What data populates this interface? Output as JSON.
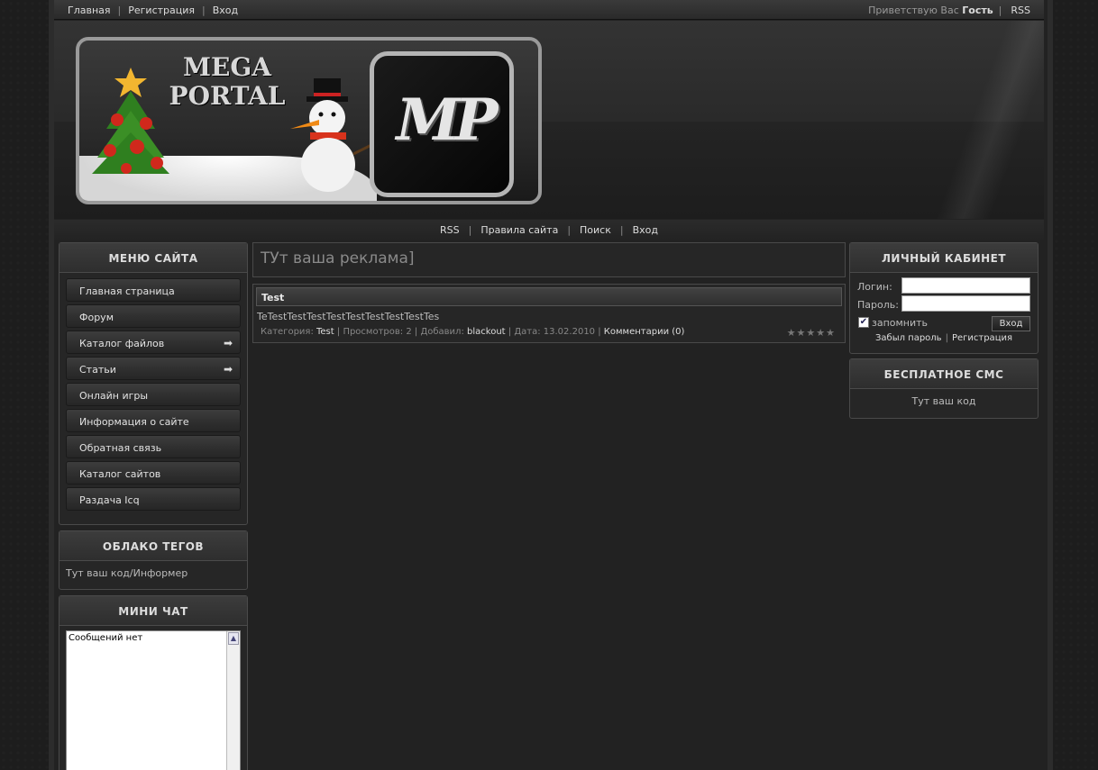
{
  "topbar": {
    "links": [
      "Главная",
      "Регистрация",
      "Вход"
    ],
    "greeting": "Приветствую Вас",
    "user": "Гость",
    "rss": "RSS"
  },
  "logo": {
    "line1": "MEGA",
    "line2": "PORTAL",
    "mark": "MP"
  },
  "navbar": {
    "links": [
      "RSS",
      "Правила сайта",
      "Поиск",
      "Вход"
    ]
  },
  "site_menu": {
    "title": "МЕНЮ САЙТА",
    "items": [
      {
        "label": "Главная страница",
        "arrow": false
      },
      {
        "label": "Форум",
        "arrow": false
      },
      {
        "label": "Каталог файлов",
        "arrow": true
      },
      {
        "label": "Статьи",
        "arrow": true
      },
      {
        "label": "Онлайн игры",
        "arrow": false
      },
      {
        "label": "Информация о сайте",
        "arrow": false
      },
      {
        "label": "Обратная связь",
        "arrow": false
      },
      {
        "label": "Каталог сайтов",
        "arrow": false
      },
      {
        "label": "Раздача Icq",
        "arrow": false
      }
    ]
  },
  "tag_cloud": {
    "title": "ОБЛАКО ТЕГОВ",
    "body": "Тут ваш код/Информер"
  },
  "mini_chat": {
    "title": "МИНИ ЧАТ",
    "message": "Сообщений нет"
  },
  "ad": {
    "text": "ТУт ваша реклама]"
  },
  "entry": {
    "title": "Test",
    "text": "TeTestTestTestTestTestTestTestTestTes",
    "category_label": "Категория:",
    "category": "Test",
    "views_label": "Просмотров:",
    "views": "2",
    "author_label": "Добавил:",
    "author": "blackout",
    "date_label": "Дата:",
    "date": "13.02.2010",
    "comments": "Комментарии (0)",
    "stars": "★★★★★"
  },
  "cabinet": {
    "title": "ЛИЧНЫЙ КАБИНЕТ",
    "login_label": "Логин:",
    "password_label": "Пароль:",
    "remember_label": "запомнить",
    "submit": "Вход",
    "forgot": "Забыл пароль",
    "register": "Регистрация"
  },
  "sms": {
    "title": "БЕСПЛАТНОЕ СМС",
    "body": "Тут ваш код"
  }
}
